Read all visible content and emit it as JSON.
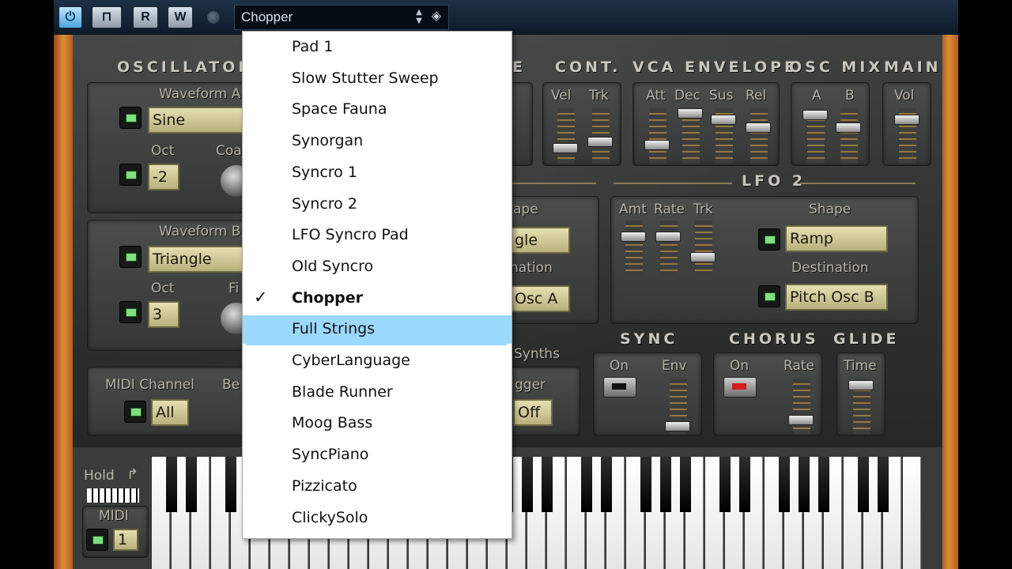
{
  "toolbar": {
    "power_icon": "power-icon",
    "read_label": "R",
    "write_label": "W",
    "preset_name": "Chopper"
  },
  "synth": {
    "oscillators_title": "OSCILLATORS",
    "waveform_a_label": "Waveform A",
    "waveform_a_value": "Sine",
    "oct_a_label": "Oct",
    "oct_a_value": "-2",
    "coarse_label": "Coa",
    "waveform_b_label": "Waveform B",
    "waveform_b_value": "Triangle",
    "oct_b_label": "Oct",
    "oct_b_value": "3",
    "fine_label": "Fi",
    "midi_channel_label": "MIDI Channel",
    "midi_channel_value": "All",
    "bend_label": "Be",
    "synths_label": "Synths",
    "trigger_label": "gger",
    "trigger_value": "Off",
    "partial_title": "E",
    "shape1_label": "ape",
    "shape1_value": "gle",
    "destination1_label": "nation",
    "destination1_value": "Osc A",
    "cont_title": "CONT.",
    "cont_vel": "Vel",
    "cont_trk": "Trk",
    "vca_title": "VCA ENVELOPE",
    "vca_att": "Att",
    "vca_dec": "Dec",
    "vca_sus": "Sus",
    "vca_rel": "Rel",
    "oscmix_title": "OSC MIX",
    "oscmix_a": "A",
    "oscmix_b": "B",
    "main_title": "MAIN",
    "main_vol": "Vol",
    "lfo2_title": "LFO 2",
    "lfo2_amt": "Amt",
    "lfo2_rate": "Rate",
    "lfo2_trk": "Trk",
    "lfo2_shape_label": "Shape",
    "lfo2_shape_value": "Ramp",
    "lfo2_dest_label": "Destination",
    "lfo2_dest_value": "Pitch Osc B",
    "sync_title": "SYNC",
    "sync_on": "On",
    "sync_env": "Env",
    "chorus_title": "CHORUS",
    "chorus_on": "On",
    "chorus_rate": "Rate",
    "glide_title": "GLIDE",
    "glide_time": "Time",
    "hold_label": "Hold",
    "midi_label": "MIDI",
    "midi_value": "1"
  },
  "preset_menu": {
    "items": [
      {
        "label": "Pad 1"
      },
      {
        "label": "Slow Stutter Sweep"
      },
      {
        "label": "Space Fauna"
      },
      {
        "label": "Synorgan"
      },
      {
        "label": "Syncro 1"
      },
      {
        "label": "Syncro 2"
      },
      {
        "label": "LFO Syncro Pad"
      },
      {
        "label": "Old Syncro"
      },
      {
        "label": "Chopper",
        "checked": true
      },
      {
        "label": "Full Strings",
        "highlighted": true
      },
      {
        "label": "CyberLanguage"
      },
      {
        "label": "Blade Runner"
      },
      {
        "label": "Moog Bass"
      },
      {
        "label": "SyncPiano"
      },
      {
        "label": "Pizzicato"
      },
      {
        "label": "ClickySolo"
      }
    ],
    "checkmark_icon": "checkmark-icon"
  },
  "colors": {
    "menu_highlight": "#9bd9ff",
    "display_lcd": "#e5dfb2",
    "led_green": "#7fe07f",
    "chorus_led": "#d31c1c"
  }
}
